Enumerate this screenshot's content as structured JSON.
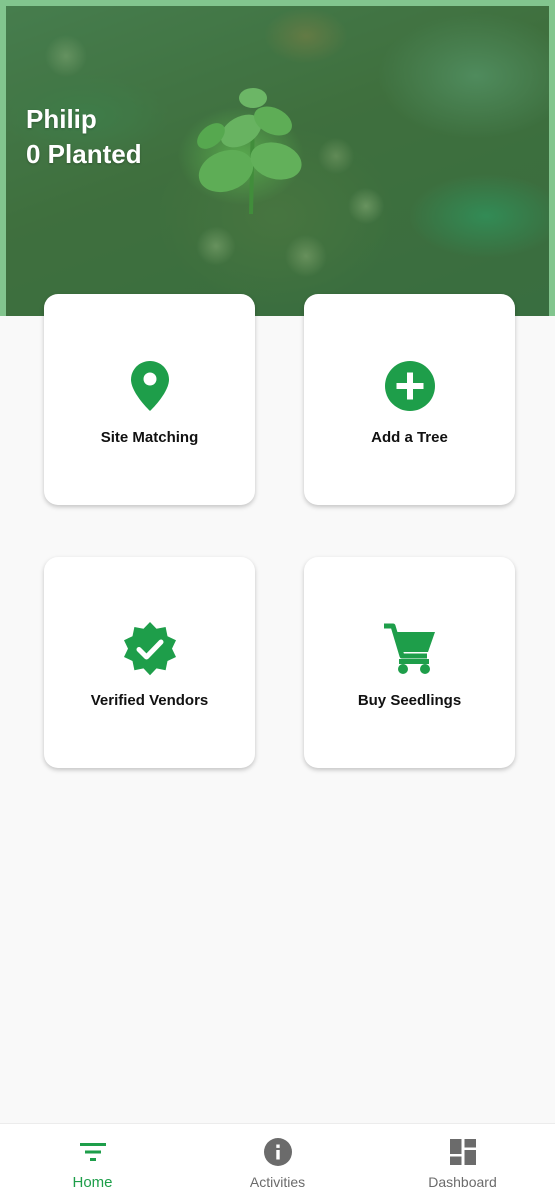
{
  "hero": {
    "user_name": "Philip",
    "planted_text": "0 Planted"
  },
  "cards": [
    {
      "label": "Site Matching",
      "icon": "location-pin-icon"
    },
    {
      "label": "Add a Tree",
      "icon": "add-circle-icon"
    },
    {
      "label": "Verified Vendors",
      "icon": "verified-badge-icon"
    },
    {
      "label": "Buy Seedlings",
      "icon": "shopping-cart-icon"
    }
  ],
  "nav": {
    "items": [
      {
        "label": "Home",
        "icon": "filter-list-icon",
        "active": true
      },
      {
        "label": "Activities",
        "icon": "info-icon",
        "active": false
      },
      {
        "label": "Dashboard",
        "icon": "dashboard-icon",
        "active": false
      }
    ]
  },
  "colors": {
    "accent": "#1e9e4a",
    "inactive": "#6b6b6b",
    "hero_frame": "#82c58e"
  }
}
